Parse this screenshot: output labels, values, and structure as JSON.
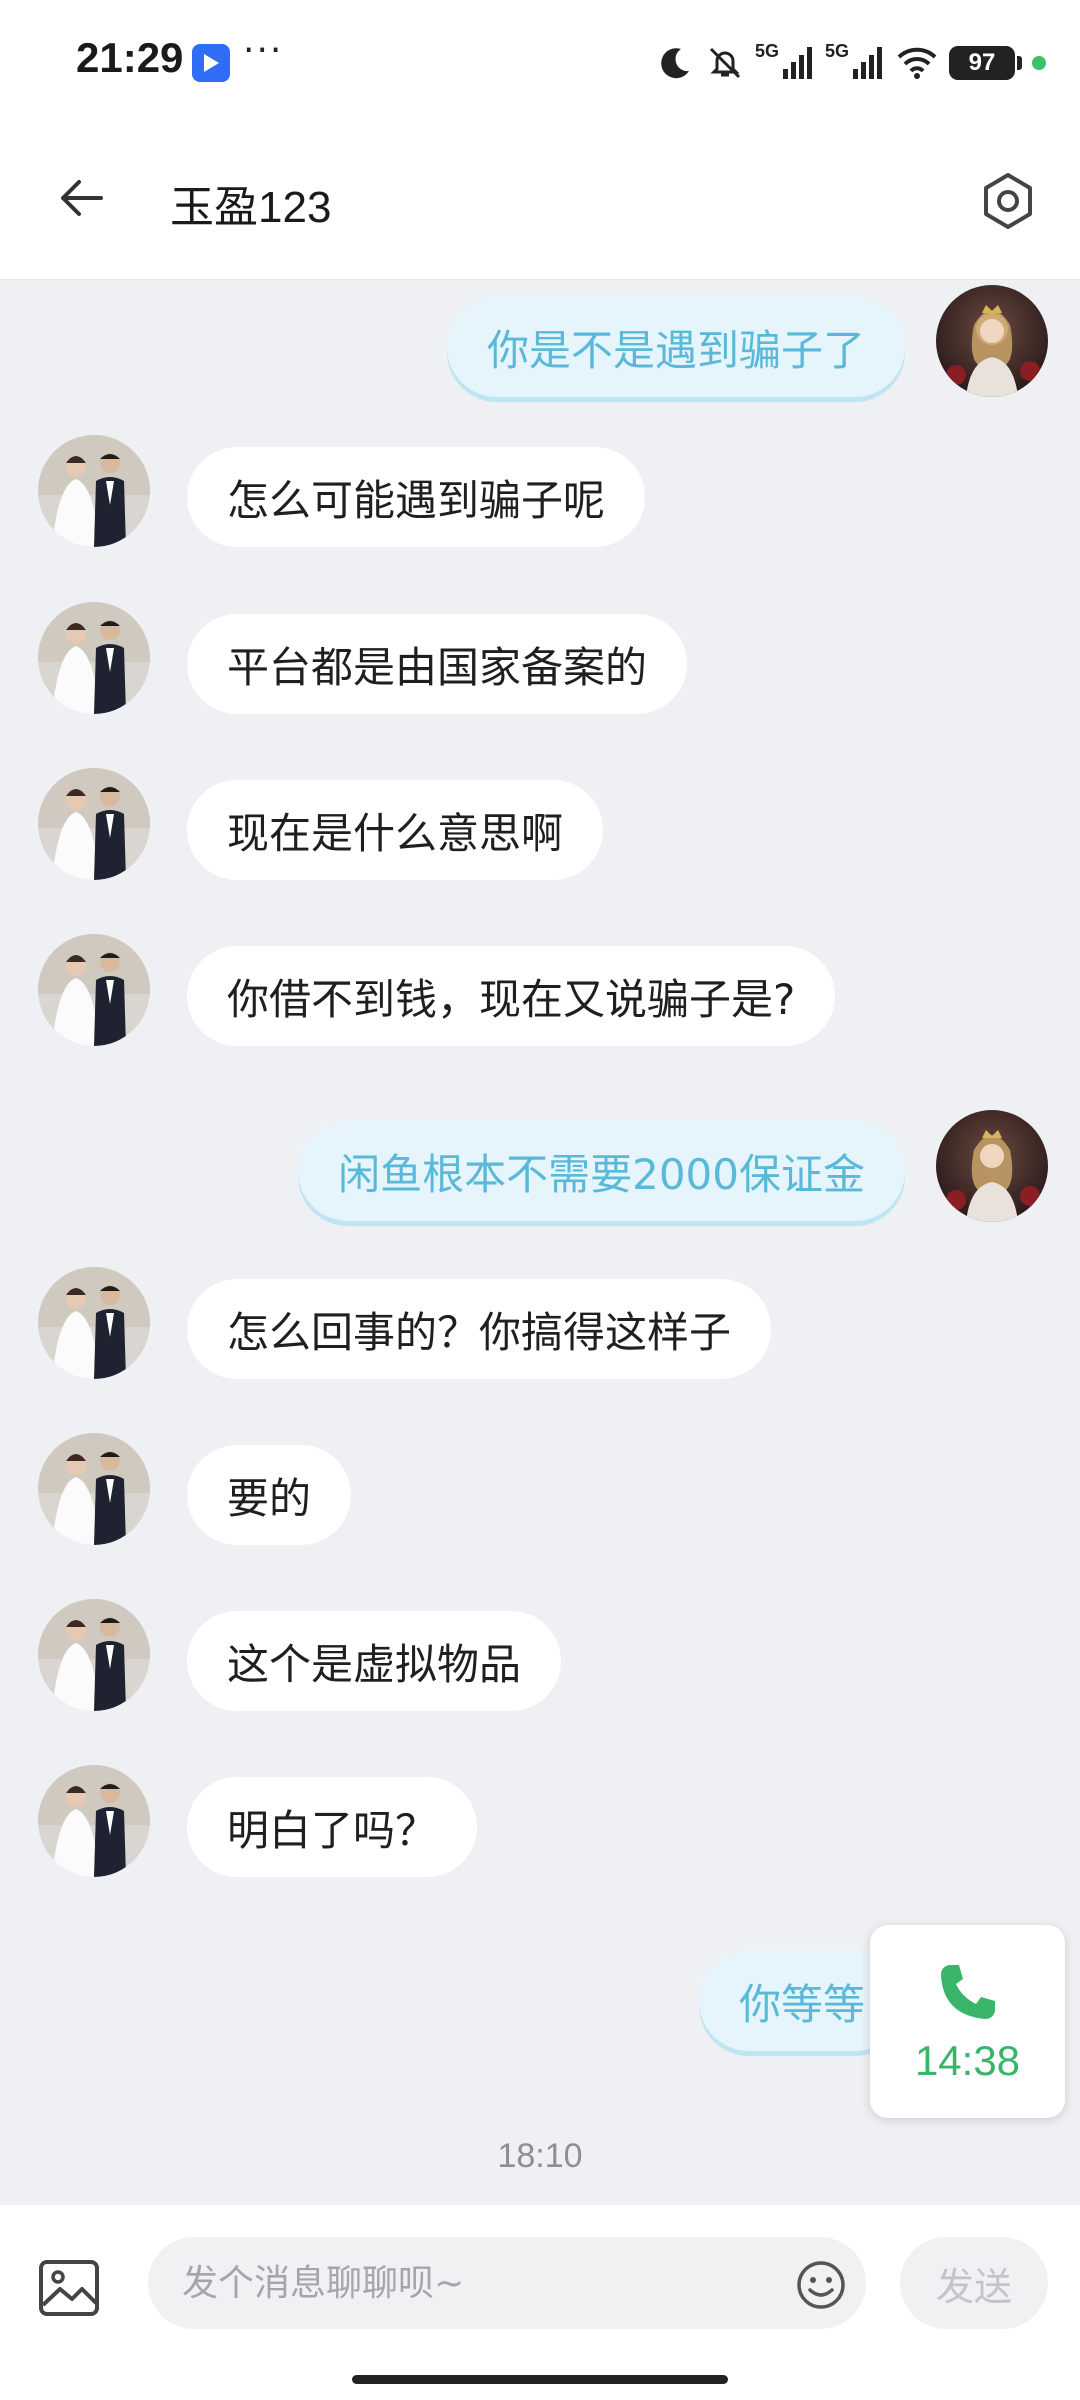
{
  "status_bar": {
    "time": "21:29",
    "more": "···",
    "signal1": "5G",
    "signal2": "5G",
    "battery": "97"
  },
  "header": {
    "title": "玉盈123",
    "back_icon": "arrow-left-icon",
    "settings_icon": "hexagon-settings-icon"
  },
  "messages": [
    {
      "side": "out",
      "text": "你是不是遇到骗子了"
    },
    {
      "side": "in",
      "text": "怎么可能遇到骗子呢"
    },
    {
      "side": "in",
      "text": "平台都是由国家备案的"
    },
    {
      "side": "in",
      "text": "现在是什么意思啊"
    },
    {
      "side": "in",
      "text": "你借不到钱，现在又说骗子是?"
    },
    {
      "side": "out",
      "text": "闲鱼根本不需要2000保证金"
    },
    {
      "side": "in",
      "text": "怎么回事的？你搞得这样子"
    },
    {
      "side": "in",
      "text": "要的"
    },
    {
      "side": "in",
      "text": "这个是虚拟物品"
    },
    {
      "side": "in",
      "text": "明白了吗？"
    },
    {
      "side": "out",
      "text": "你等等"
    }
  ],
  "timestamp": "18:10",
  "call_widget": {
    "icon": "phone-icon",
    "duration": "14:38",
    "color": "#39b56a"
  },
  "input_bar": {
    "placeholder": "发个消息聊聊呗~",
    "value": "",
    "send_label": "发送",
    "image_icon": "image-icon",
    "emoji_icon": "emoji-icon"
  },
  "colors": {
    "outgoing_bubble": "#e6f5fb",
    "outgoing_text": "#5ab9d9",
    "incoming_bubble": "#ffffff",
    "background": "#eef0f3"
  }
}
